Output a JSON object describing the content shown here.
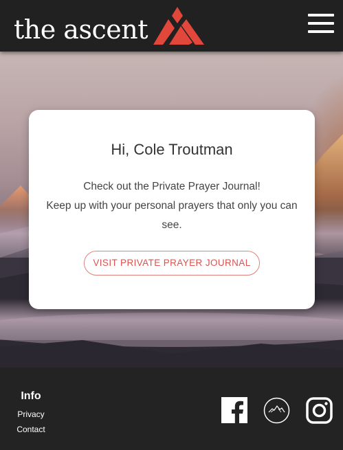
{
  "header": {
    "logo_text": "the ascent",
    "logo_icon": "ascent-mountain-logo",
    "menu_icon": "hamburger-menu-icon"
  },
  "card": {
    "greeting": "Hi, Cole Troutman",
    "message_line1": "Check out the Private Prayer Journal!",
    "message_line2": "Keep up with your personal prayers that only you can see.",
    "cta_label": "VISIT PRIVATE PRAYER JOURNAL"
  },
  "footer": {
    "info_title": "Info",
    "links": [
      "Privacy",
      "Contact"
    ],
    "social_icons": [
      "facebook-icon",
      "ascent-circle-icon",
      "instagram-icon"
    ]
  },
  "colors": {
    "header_bg": "#212121",
    "accent": "#e2473b",
    "cta_text": "#d9534f",
    "footer_bg": "#232323"
  }
}
